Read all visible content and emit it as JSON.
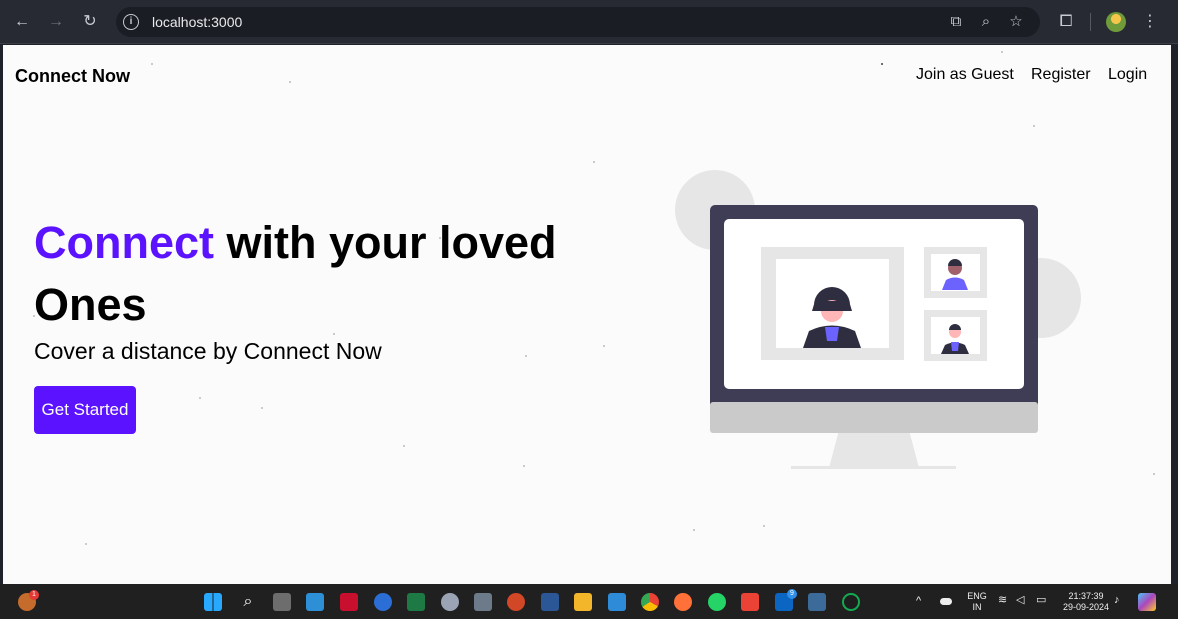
{
  "browser": {
    "url": "localhost:3000",
    "icons": [
      "back-arrow-icon",
      "forward-arrow-icon",
      "reload-icon",
      "site-info-icon",
      "install-app-icon",
      "zoom-icon",
      "bookmark-star-icon",
      "extensions-icon",
      "profile-avatar",
      "menu-kebab-icon"
    ]
  },
  "navbar": {
    "brand": "Connect Now",
    "links": [
      "Join as Guest",
      "Register",
      "Login"
    ]
  },
  "hero": {
    "title_accent": "Connect",
    "title_rest": " with your loved Ones",
    "subtitle": "Cover a distance by Connect Now",
    "cta": "Get Started"
  },
  "colors": {
    "accent": "#5b12ff",
    "monitor_frame": "#3f3d56",
    "page_bg": "#fbfbfb"
  },
  "taskbar": {
    "language": "ENG",
    "region": "IN",
    "time": "21:37:39",
    "date": "29-09-2024",
    "notification_count": "1",
    "linkedin_badge": "9"
  }
}
